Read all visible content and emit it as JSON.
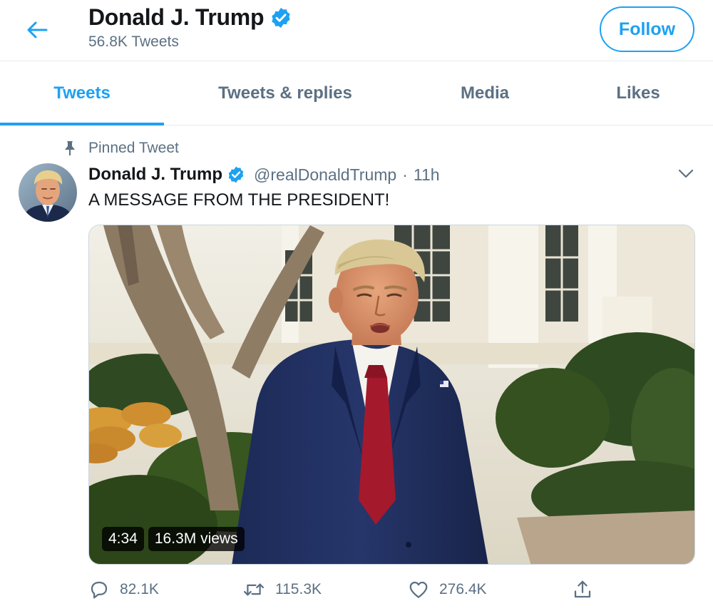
{
  "header": {
    "title": "Donald J. Trump",
    "tweet_count": "56.8K Tweets",
    "follow_label": "Follow",
    "back_icon": "back-arrow-icon",
    "verified_icon": "verified-badge-icon"
  },
  "tabs": [
    {
      "label": "Tweets",
      "active": true
    },
    {
      "label": "Tweets & replies",
      "active": false
    },
    {
      "label": "Media",
      "active": false
    },
    {
      "label": "Likes",
      "active": false
    }
  ],
  "pinned_label": "Pinned Tweet",
  "tweet": {
    "name": "Donald J. Trump",
    "handle": "@realDonaldTrump",
    "separator": "·",
    "time": "11h",
    "text": "A MESSAGE FROM THE PRESIDENT!",
    "video_duration": "4:34",
    "video_views": "16.3M views",
    "replies": "82.1K",
    "retweets": "115.3K",
    "likes": "276.4K"
  },
  "colors": {
    "accent": "#1da1f2",
    "secondary_text": "#5b7083",
    "border": "#e6ecf0"
  }
}
